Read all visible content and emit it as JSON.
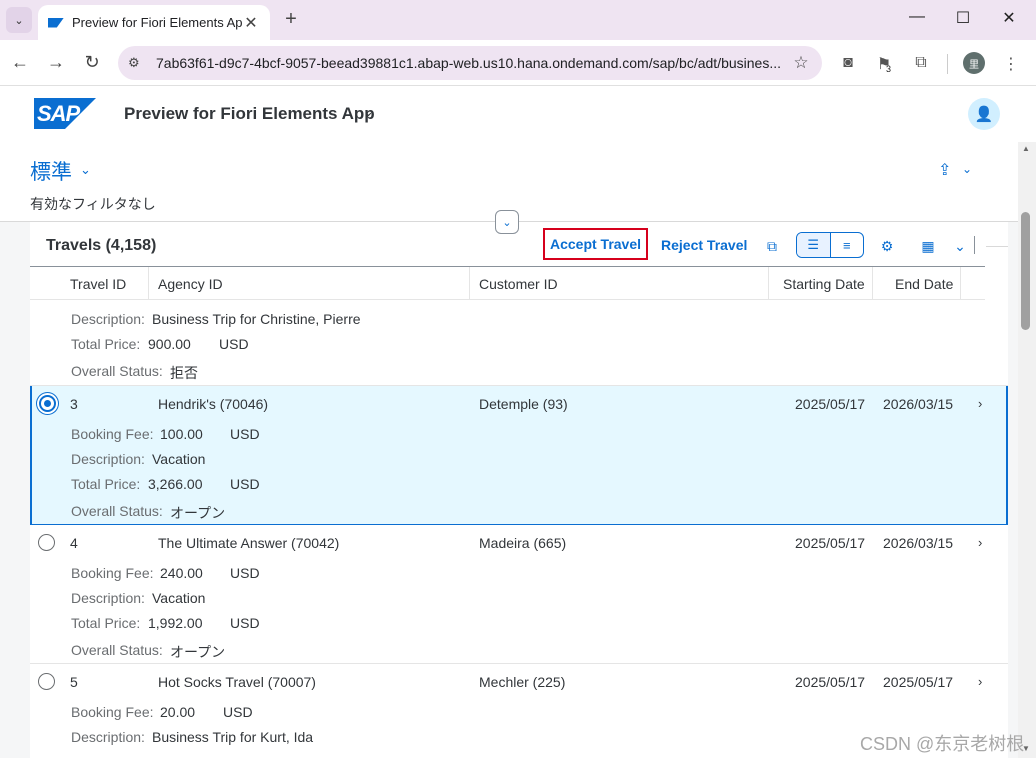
{
  "browser": {
    "tab_title": "Preview for Fiori Elements App",
    "url": "7ab63f61-d9c7-4bcf-9057-beead39881c1.abap-web.us10.hana.ondemand.com/sap/bc/adt/busines...",
    "flag_badge": "3",
    "profile_initial": "里"
  },
  "shell": {
    "logo_text": "SAP",
    "app_title": "Preview for Fiori Elements App"
  },
  "header": {
    "variant_name": "標準",
    "filter_status": "有効なフィルタなし"
  },
  "table": {
    "title": "Travels (4,158)",
    "accept_label": "Accept Travel",
    "reject_label": "Reject Travel",
    "columns": [
      "Travel ID",
      "Agency ID",
      "Customer ID",
      "Starting Date",
      "End Date"
    ],
    "labels": {
      "booking_fee": "Booking Fee:",
      "description": "Description:",
      "total_price": "Total Price:",
      "overall_status": "Overall Status:"
    },
    "partial_row": {
      "description": "Business Trip for Christine, Pierre",
      "total_price": "900.00",
      "currency": "USD",
      "overall_status": "拒否"
    },
    "rows": [
      {
        "travel_id": "3",
        "agency": "Hendrik's (70046)",
        "customer": "Detemple (93)",
        "start": "2025/05/17",
        "end": "2026/03/15",
        "booking_fee": "100.00",
        "description": "Vacation",
        "total_price": "3,266.00",
        "currency": "USD",
        "overall_status": "オープン"
      },
      {
        "travel_id": "4",
        "agency": "The Ultimate Answer (70042)",
        "customer": "Madeira (665)",
        "start": "2025/05/17",
        "end": "2026/03/15",
        "booking_fee": "240.00",
        "description": "Vacation",
        "total_price": "1,992.00",
        "currency": "USD",
        "overall_status": "オープン"
      },
      {
        "travel_id": "5",
        "agency": "Hot Socks Travel (70007)",
        "customer": "Mechler (225)",
        "start": "2025/05/17",
        "end": "2025/05/17",
        "booking_fee": "20.00",
        "description": "Business Trip for Kurt, Ida",
        "currency": "USD"
      }
    ]
  },
  "watermark": "CSDN @东京老树根",
  "colors": {
    "brand": "#0a6ed1",
    "selected_row": "#e5f8ff",
    "highlight_border": "#d6001c"
  }
}
